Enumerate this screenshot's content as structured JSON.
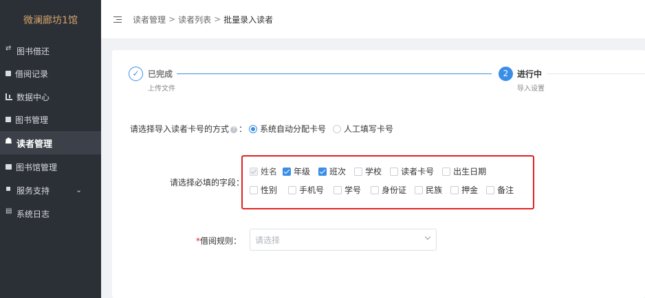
{
  "app": {
    "title": "微澜廊坊1馆"
  },
  "sidebar": {
    "items": [
      {
        "label": "图书借还",
        "icon": "swap-icon"
      },
      {
        "label": "借阅记录",
        "icon": "record-icon"
      },
      {
        "label": "数据中心",
        "icon": "chart-icon"
      },
      {
        "label": "图书管理",
        "icon": "book-icon"
      },
      {
        "label": "读者管理",
        "icon": "users-icon",
        "active": true
      },
      {
        "label": "图书馆管理",
        "icon": "library-icon"
      },
      {
        "label": "服务支持",
        "icon": "service-icon",
        "has_submenu": true
      },
      {
        "label": "系统日志",
        "icon": "log-icon"
      }
    ]
  },
  "header": {
    "breadcrumb": [
      "读者管理",
      "读者列表",
      "批量录入读者"
    ],
    "separator": ">"
  },
  "steps": [
    {
      "marker": "✓",
      "title": "已完成",
      "desc": "上传文件",
      "status": "done"
    },
    {
      "marker": "2",
      "title": "进行中",
      "desc": "导入设置",
      "status": "active"
    }
  ],
  "form": {
    "card_mode": {
      "label": "请选择导入读者卡号的方式",
      "help_icon": "?",
      "colon": "：",
      "options": [
        {
          "label": "系统自动分配卡号",
          "selected": true
        },
        {
          "label": "人工填写卡号",
          "selected": false
        }
      ]
    },
    "required_fields": {
      "label": "请选择必填的字段：",
      "row1": [
        {
          "label": "姓名",
          "state": "disabled-checked"
        },
        {
          "label": "年级",
          "state": "checked"
        },
        {
          "label": "班次",
          "state": "checked"
        },
        {
          "label": "学校",
          "state": "unchecked"
        },
        {
          "label": "读者卡号",
          "state": "unchecked"
        },
        {
          "label": "出生日期",
          "state": "unchecked"
        }
      ],
      "row2": [
        {
          "label": "性别",
          "state": "unchecked"
        },
        {
          "label": "手机号",
          "state": "unchecked"
        },
        {
          "label": "学号",
          "state": "unchecked"
        },
        {
          "label": "身份证",
          "state": "unchecked"
        },
        {
          "label": "民族",
          "state": "unchecked"
        },
        {
          "label": "押金",
          "state": "unchecked"
        },
        {
          "label": "备注",
          "state": "unchecked"
        }
      ]
    },
    "borrow_rule": {
      "required_mark": "*",
      "label": "借阅规则：",
      "placeholder": "请选择"
    }
  },
  "colors": {
    "sidebar_bg": "#2b2f36",
    "sidebar_active_bg": "#3c4049",
    "logo": "#d6a56e",
    "accent": "#3a8ee6",
    "highlight": "#e02020"
  }
}
